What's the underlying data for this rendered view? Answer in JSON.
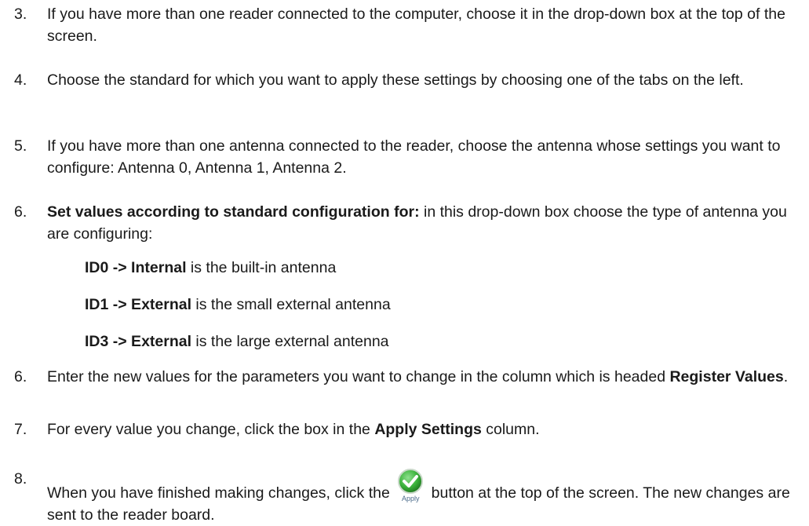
{
  "steps": [
    {
      "num": "3.",
      "text": "If you have more than one reader connected to the computer, choose it in the drop-down box at the top of the screen."
    },
    {
      "num": "4.",
      "text": "Choose the standard for which you want to apply these settings by choosing one of the tabs on the left."
    },
    {
      "num": "5.",
      "text": "If you have more than one antenna connected to the reader, choose the antenna whose settings you want to configure: Antenna 0, Antenna 1, Antenna 2."
    },
    {
      "num": "6.",
      "bold": "Set values according to standard configuration for:",
      "text": " in this drop-down box choose the type of antenna you are configuring:",
      "subitems": [
        {
          "bold": "ID0 -> Internal",
          "text": " is the built-in antenna"
        },
        {
          "bold": "ID1 -> External",
          "text": " is the small external antenna"
        },
        {
          "bold": "ID3 -> External",
          "text": " is the large external antenna"
        }
      ]
    },
    {
      "num": "6.",
      "text_before": "Enter the new values for the parameters you want to change in the column which is headed ",
      "bold": "Register Values",
      "text_after": "."
    },
    {
      "num": "7.",
      "text_before": "For every value you change, click the box in the ",
      "bold": "Apply Settings",
      "text_after": " column."
    },
    {
      "num": "8.",
      "text_before": "When you have finished making changes, click the ",
      "button_label": "Apply",
      "text_after": " button at the top of the screen. The new changes are sent to the reader board."
    }
  ],
  "colors": {
    "text": "#1a1a1a",
    "apply_green": "#3cb43c"
  },
  "icons": {
    "apply": "checkmark-circle-icon"
  }
}
